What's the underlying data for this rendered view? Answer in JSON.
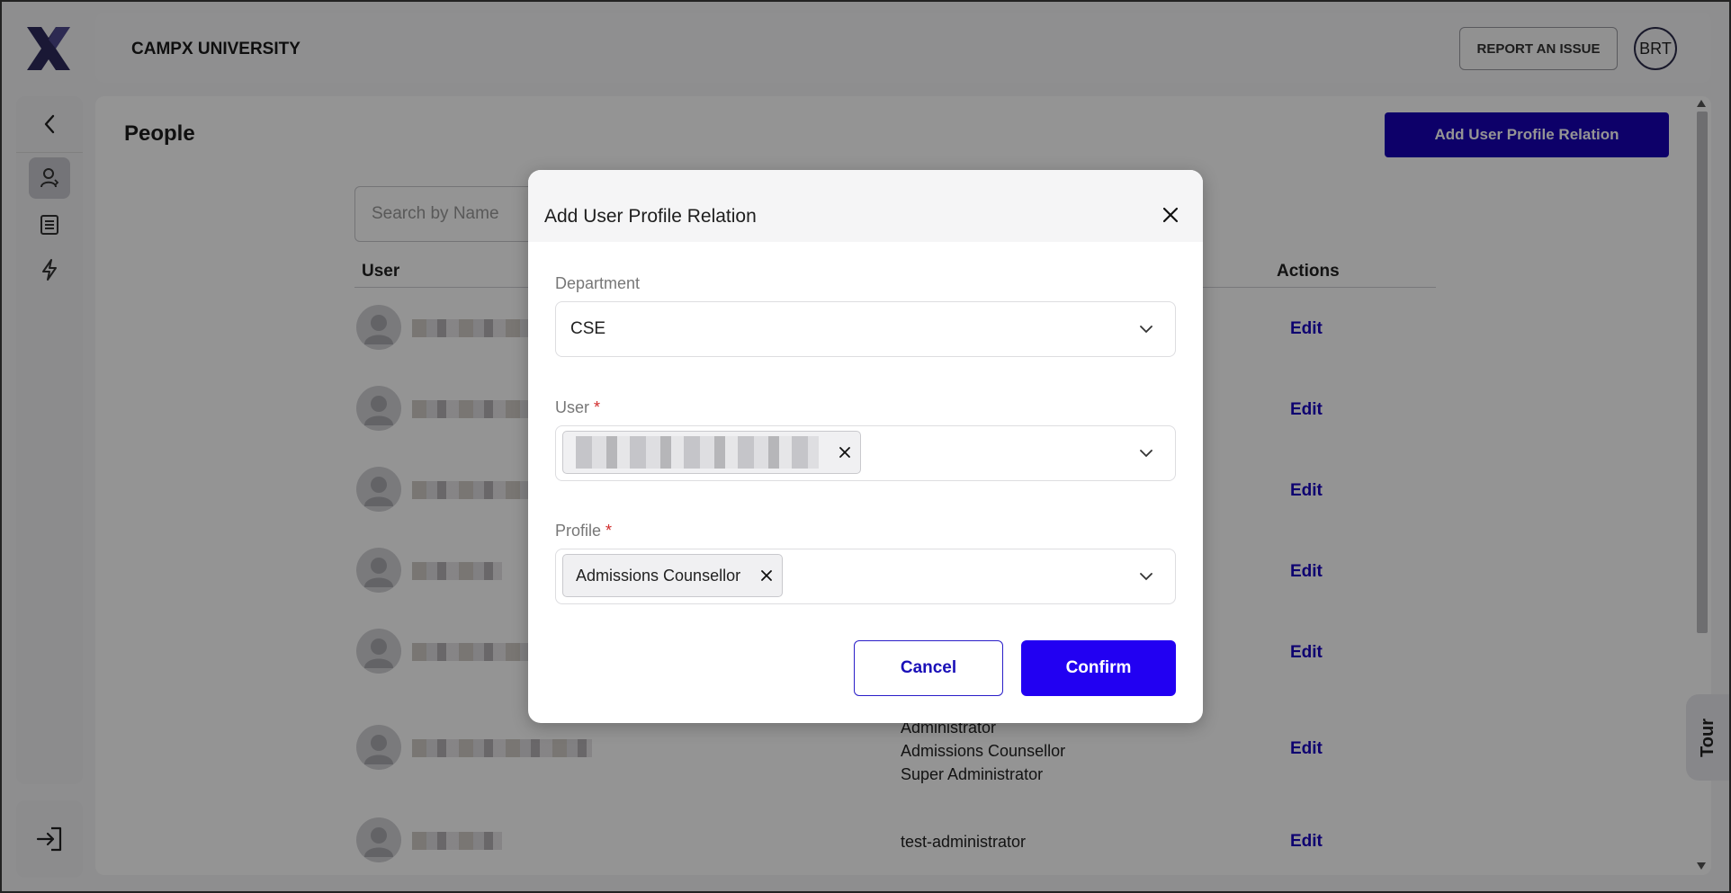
{
  "app": {
    "university_name": "CAMPX UNIVERSITY",
    "logo_icon": "campx-logo-icon"
  },
  "header": {
    "report_label": "REPORT AN ISSUE",
    "avatar_initials": "BRT"
  },
  "sidebar": {
    "items": [
      {
        "icon": "chevron-left-icon"
      },
      {
        "icon": "people-icon",
        "active": true
      },
      {
        "icon": "document-icon"
      },
      {
        "icon": "bolt-icon"
      }
    ],
    "logout_icon": "logout-icon"
  },
  "page": {
    "title": "People",
    "add_button_label": "Add User Profile Relation",
    "search_placeholder": "Search by Name",
    "columns": {
      "user": "User",
      "actions": "Actions"
    },
    "rows": [
      {
        "edit": "Edit"
      },
      {
        "edit": "Edit"
      },
      {
        "edit": "Edit"
      },
      {
        "edit": "Edit"
      },
      {
        "edit": "Edit"
      },
      {
        "edit": "Edit",
        "profiles": [
          "Administrator",
          "Admissions Counsellor",
          "Super Administrator"
        ]
      },
      {
        "edit": "Edit",
        "profiles": [
          "test-administrator"
        ]
      }
    ],
    "tour_label": "Tour"
  },
  "modal": {
    "title": "Add User Profile Relation",
    "department_label": "Department",
    "department_value": "CSE",
    "user_label": "User",
    "profile_label": "Profile",
    "required_mark": "*",
    "profile_chip": "Admissions Counsellor",
    "cancel_label": "Cancel",
    "confirm_label": "Confirm"
  },
  "colors": {
    "primary": "#1800b5",
    "confirm": "#2200f2",
    "required": "#d12b2b"
  }
}
